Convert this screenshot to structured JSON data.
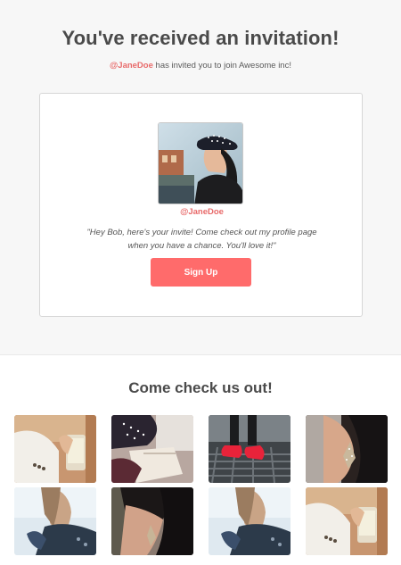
{
  "header": {
    "title": "You've received an invitation!",
    "inviter_handle": "@JaneDoe",
    "invite_text": "has invited you to join Awesome inc!"
  },
  "card": {
    "avatar_icon": "profile-photo",
    "handle": "@JaneDoe",
    "quote": "\"Hey Bob, here's your invite! Come check out my profile page when you have a chance. You'll love it!\"",
    "signup_label": "Sign Up"
  },
  "gallery": {
    "title": "Come check us out!",
    "photos": [
      "photo-drink",
      "photo-hat-reading",
      "photo-red-shoes",
      "photo-earring",
      "photo-jacket-meditate",
      "photo-earring-dark",
      "photo-jacket-meditate-2",
      "photo-drink-2"
    ]
  },
  "colors": {
    "accent": "#ff6b6b",
    "handle": "#e86a6a",
    "top_background": "#f7f7f7"
  }
}
